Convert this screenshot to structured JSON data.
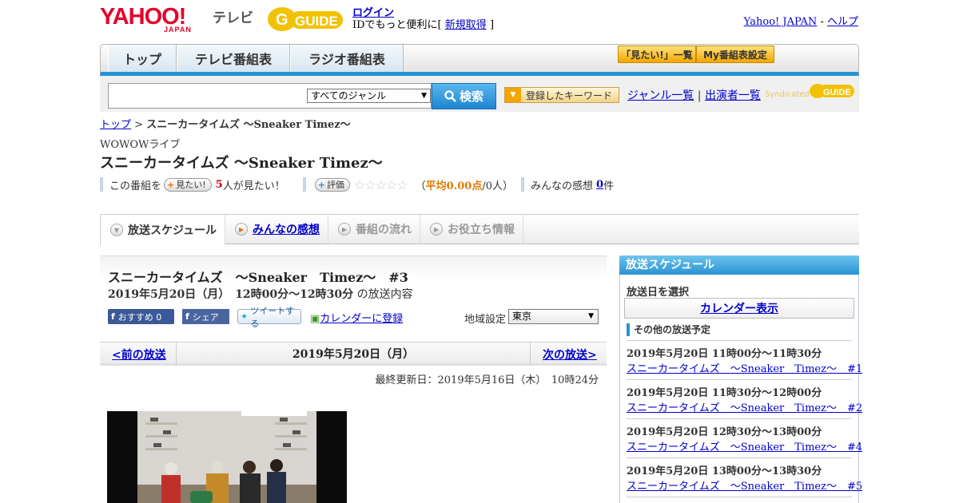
{
  "header": {
    "logo_text": "YAHOO!",
    "logo_sub": "JAPAN",
    "tv_label": "テレビ",
    "gguide_logo": "G GUIDE",
    "login": "ログイン",
    "login_sub_prefix": "IDでもっと便利に[",
    "signup": "新規取得",
    "login_sub_suffix": "]",
    "yahoo_japan": "Yahoo! JAPAN",
    "sep": "-",
    "help": "ヘルプ"
  },
  "nav": {
    "tabs": [
      "トップ",
      "テレビ番組表",
      "ラジオ番組表"
    ],
    "mitai_list": "「見たい!」一覧",
    "my_settings": "My番組表設定"
  },
  "search": {
    "genre_selected": "すべてのジャンル",
    "button": "検索",
    "keyword_button": "登録したキーワード",
    "genre_list": "ジャンル一覧",
    "divider": "|",
    "performer_list": "出演者一覧",
    "syndicated": "Syndicated"
  },
  "breadcrumb": {
    "home": "トップ",
    "sep": ">",
    "current": "スニーカータイムズ ～Sneaker Timez～"
  },
  "program": {
    "channel": "WOWOWライブ",
    "title": "スニーカータイムズ ～Sneaker Timez～",
    "mitai_prefix": "この番組を",
    "mitai_button": "見たい!",
    "mitai_count": "5",
    "mitai_suffix": "人が見たい！",
    "rate_button": "評価",
    "stars": [
      "☆",
      "☆",
      "☆",
      "☆",
      "☆"
    ],
    "rating_open": "（",
    "rating_avg": "平均0.00点",
    "rating_people": "/0人）",
    "impressions_label": "みんなの感想",
    "impressions_count": "0",
    "impressions_unit": "件"
  },
  "tabs": [
    {
      "label": "放送スケジュール",
      "icon": "chevron-down-icon"
    },
    {
      "label": "みんなの感想",
      "icon": "play-icon"
    },
    {
      "label": "番組の流れ",
      "icon": "play-icon"
    },
    {
      "label": "お役立ち情報",
      "icon": "play-icon"
    }
  ],
  "episode": {
    "title": "スニーカータイムズ　～Sneaker　Timez～　#3",
    "datetime": "2019年5月20日（月）　12時00分～12時30分",
    "datetime_suffix": "の放送内容",
    "fb_recommend": "おすすめ 0",
    "fb_share": "シェア",
    "tweet": "ツイートする",
    "calendar": "カレンダーに登録",
    "region_label": "地域設定",
    "region_value": "東京",
    "prev": "<前の放送",
    "current_date": "2019年5月20日（月）",
    "next": "次の放送>",
    "updated": "最終更新日：2019年5月16日（木）　10時24分"
  },
  "sidebar": {
    "heading": "放送スケジュール",
    "select_date": "放送日を選択",
    "calendar_button": "カレンダー表示",
    "other_label": "その他の放送予定",
    "items": [
      {
        "time": "2019年5月20日  11時00分～11時30分",
        "title": "スニーカータイムズ　～Sneaker　Timez～　#1"
      },
      {
        "time": "2019年5月20日  11時30分～12時00分",
        "title": "スニーカータイムズ　～Sneaker　Timez～　#2"
      },
      {
        "time": "2019年5月20日  12時30分～13時00分",
        "title": "スニーカータイムズ　～Sneaker　Timez～　#4"
      },
      {
        "time": "2019年5月20日  13時00分～13時30分",
        "title": "スニーカータイムズ　～Sneaker　Timez～　#5"
      }
    ]
  },
  "colors": {
    "accent_blue": "#2494d6",
    "yahoo_red": "#e5002c",
    "gguide_yellow": "#f2c200",
    "link": "#0000cc",
    "count_red": "#cc0000",
    "rating_orange": "#e07b00"
  }
}
